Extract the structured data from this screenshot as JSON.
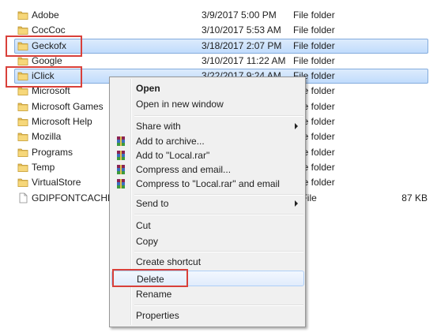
{
  "files": [
    {
      "name": "Adobe",
      "date": "3/9/2017 5:00 PM",
      "type": "File folder",
      "size": "",
      "icon": "folder-icon",
      "selected": false
    },
    {
      "name": "CocCoc",
      "date": "3/10/2017 5:53 AM",
      "type": "File folder",
      "size": "",
      "icon": "folder-icon",
      "selected": false
    },
    {
      "name": "Geckofx",
      "date": "3/18/2017 2:07 PM",
      "type": "File folder",
      "size": "",
      "icon": "folder-icon",
      "selected": true
    },
    {
      "name": "Google",
      "date": "3/10/2017 11:22 AM",
      "type": "File folder",
      "size": "",
      "icon": "folder-icon",
      "selected": false
    },
    {
      "name": "iClick",
      "date": "3/22/2017 9:24 AM",
      "type": "File folder",
      "size": "",
      "icon": "folder-icon",
      "selected": true
    },
    {
      "name": "Microsoft",
      "date": "",
      "type": "File folder",
      "size": "",
      "icon": "folder-icon",
      "selected": false
    },
    {
      "name": "Microsoft Games",
      "date": "",
      "type": "File folder",
      "size": "",
      "icon": "folder-icon",
      "selected": false
    },
    {
      "name": "Microsoft Help",
      "date": "",
      "type": "File folder",
      "size": "",
      "icon": "folder-icon",
      "selected": false
    },
    {
      "name": "Mozilla",
      "date": "",
      "type": "File folder",
      "size": "",
      "icon": "folder-icon",
      "selected": false
    },
    {
      "name": "Programs",
      "date": "",
      "type": "File folder",
      "size": "",
      "icon": "folder-icon",
      "selected": false
    },
    {
      "name": "Temp",
      "date": "",
      "type": "File folder",
      "size": "",
      "icon": "folder-icon",
      "selected": false
    },
    {
      "name": "VirtualStore",
      "date": "",
      "type": "File folder",
      "size": "",
      "icon": "folder-icon",
      "selected": false
    },
    {
      "name": "GDIPFONTCACHEV1",
      "date": "",
      "type": "T File",
      "size": "87 KB",
      "icon": "file-icon",
      "selected": false
    }
  ],
  "context_menu": {
    "items": [
      {
        "label": "Open",
        "bold": true,
        "submenu": false,
        "icon": ""
      },
      {
        "label": "Open in new window",
        "bold": false,
        "submenu": false,
        "icon": ""
      },
      {
        "label": "Share with",
        "bold": false,
        "submenu": true,
        "icon": ""
      },
      {
        "label": "Add to archive...",
        "bold": false,
        "submenu": false,
        "icon": "winrar-icon"
      },
      {
        "label": "Add to \"Local.rar\"",
        "bold": false,
        "submenu": false,
        "icon": "winrar-icon"
      },
      {
        "label": "Compress and email...",
        "bold": false,
        "submenu": false,
        "icon": "winrar-icon"
      },
      {
        "label": "Compress to \"Local.rar\" and email",
        "bold": false,
        "submenu": false,
        "icon": "winrar-icon"
      },
      {
        "label": "Send to",
        "bold": false,
        "submenu": true,
        "icon": ""
      },
      {
        "label": "Cut",
        "bold": false,
        "submenu": false,
        "icon": ""
      },
      {
        "label": "Copy",
        "bold": false,
        "submenu": false,
        "icon": ""
      },
      {
        "label": "Create shortcut",
        "bold": false,
        "submenu": false,
        "icon": ""
      },
      {
        "label": "Delete",
        "bold": false,
        "submenu": false,
        "icon": "",
        "highlighted": true
      },
      {
        "label": "Rename",
        "bold": false,
        "submenu": false,
        "icon": ""
      },
      {
        "label": "Properties",
        "bold": false,
        "submenu": false,
        "icon": ""
      }
    ]
  },
  "colors": {
    "highlight_box": "#d9403a",
    "selection": "#c1dcfc",
    "folder": "#e8c15a"
  }
}
